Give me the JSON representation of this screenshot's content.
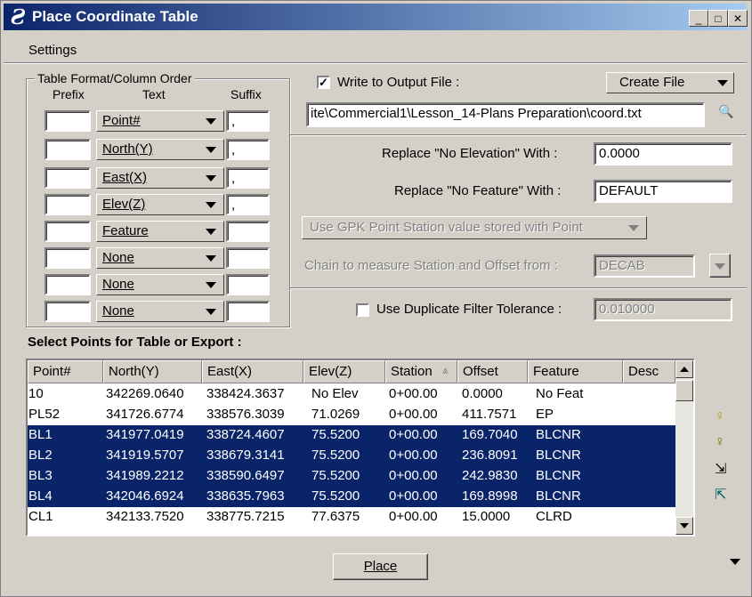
{
  "window": {
    "title": "Place Coordinate Table",
    "logo_glyph": "Ƨ"
  },
  "titlebar_buttons": {
    "minimize": "_",
    "maximize": "□",
    "close": "✕"
  },
  "menu": {
    "settings": "Settings"
  },
  "table_format": {
    "group_title": "Table Format/Column Order",
    "prefix_header": "Prefix",
    "text_header": "Text",
    "suffix_header": "Suffix",
    "rows": [
      {
        "prefix": "",
        "text": "Point#",
        "suffix": ","
      },
      {
        "prefix": "",
        "text": "North(Y)",
        "suffix": ","
      },
      {
        "prefix": "",
        "text": "East(X)",
        "suffix": ","
      },
      {
        "prefix": "",
        "text": "Elev(Z)",
        "suffix": ","
      },
      {
        "prefix": "",
        "text": "Feature",
        "suffix": ""
      },
      {
        "prefix": "",
        "text": "None",
        "suffix": ""
      },
      {
        "prefix": "",
        "text": "None",
        "suffix": ""
      },
      {
        "prefix": "",
        "text": "None",
        "suffix": ""
      }
    ]
  },
  "output": {
    "write_label": "Write to Output File :",
    "write_checked": true,
    "check_glyph": "✓",
    "create_file": "Create File",
    "file_path": "ite\\Commercial1\\Lesson_14-Plans Preparation\\coord.txt",
    "search_icon_glyph": "🔍"
  },
  "replace": {
    "elev_label": "Replace \"No Elevation\" With :",
    "elev_value": "0.0000",
    "feature_label": "Replace \"No Feature\" With :",
    "feature_value": "DEFAULT"
  },
  "gpk": {
    "label": "Use GPK Point Station value stored with Point"
  },
  "chain": {
    "label": "Chain to measure Station and Offset from :",
    "value": "DECAB"
  },
  "duplicate": {
    "label": "Use Duplicate Filter Tolerance :",
    "value": "0.010000",
    "checked": false
  },
  "points": {
    "heading": "Select Points for Table or Export :",
    "columns": [
      "Point#",
      "North(Y)",
      "East(X)",
      "Elev(Z)",
      "Station",
      "Offset",
      "Feature",
      "Desc"
    ],
    "sort_glyph": "⩓",
    "rows": [
      {
        "point": "10",
        "north": "342269.0640",
        "east": "338424.3637",
        "elev": "No Elev",
        "station": "0+00.00",
        "offset": "0.0000",
        "feature": "No Feat",
        "selected": false
      },
      {
        "point": "PL52",
        "north": "341726.6774",
        "east": "338576.3039",
        "elev": "71.0269",
        "station": "0+00.00",
        "offset": "411.7571",
        "feature": "EP",
        "selected": false
      },
      {
        "point": "BL1",
        "north": "341977.0419",
        "east": "338724.4607",
        "elev": "75.5200",
        "station": "0+00.00",
        "offset": "169.7040",
        "feature": "BLCNR",
        "selected": true
      },
      {
        "point": "BL2",
        "north": "341919.5707",
        "east": "338679.3141",
        "elev": "75.5200",
        "station": "0+00.00",
        "offset": "236.8091",
        "feature": "BLCNR",
        "selected": true
      },
      {
        "point": "BL3",
        "north": "341989.2212",
        "east": "338590.6497",
        "elev": "75.5200",
        "station": "0+00.00",
        "offset": "242.9830",
        "feature": "BLCNR",
        "selected": true
      },
      {
        "point": "BL4",
        "north": "342046.6924",
        "east": "338635.7963",
        "elev": "75.5200",
        "station": "0+00.00",
        "offset": "169.8998",
        "feature": "BLCNR",
        "selected": true
      },
      {
        "point": "CL1",
        "north": "342133.7520",
        "east": "338775.7215",
        "elev": "77.6375",
        "station": "0+00.00",
        "offset": "15.0000",
        "feature": "CLRD",
        "selected": false
      }
    ]
  },
  "side_icons": [
    "select-all-icon",
    "deselect-all-icon",
    "select-in-view-icon",
    "graphic-select-icon"
  ],
  "side_icon_glyphs": [
    "♀",
    "♀",
    "⇲",
    "⇱"
  ],
  "place_button": "Place",
  "colors": {
    "title_start": "#0a246a",
    "title_end": "#a6caf0",
    "selection": "#0a246a",
    "face": "#d4d0c8"
  }
}
